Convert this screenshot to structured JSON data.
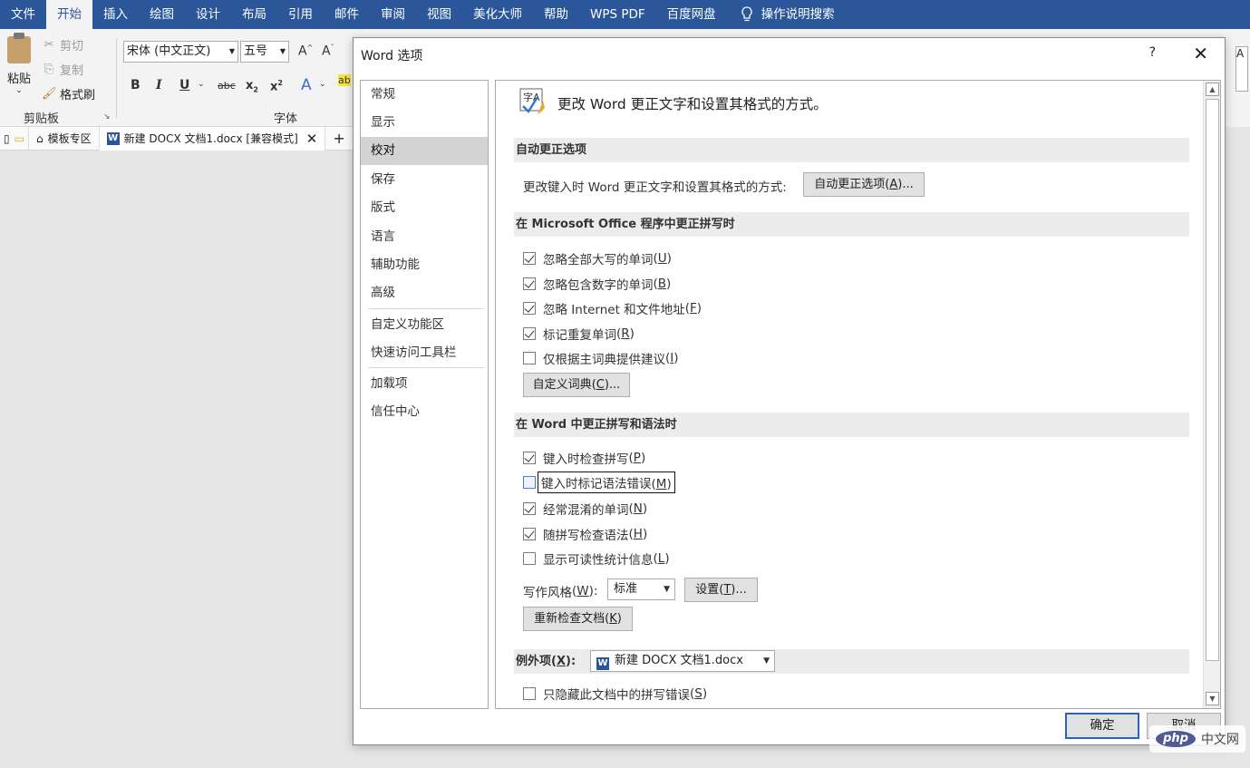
{
  "ribbon": {
    "tabs": [
      "文件",
      "开始",
      "插入",
      "绘图",
      "设计",
      "布局",
      "引用",
      "邮件",
      "审阅",
      "视图",
      "美化大师",
      "帮助",
      "WPS PDF",
      "百度网盘"
    ],
    "active_tab": "开始",
    "search_label": "操作说明搜索",
    "clipboard": {
      "paste": "粘贴",
      "cut": "剪切",
      "copy": "复制",
      "format_painter": "格式刷",
      "group_label": "剪贴板"
    },
    "font": {
      "font_name": "宋体 (中文正文)",
      "font_size": "五号",
      "group_label": "字体"
    },
    "right_partial": "A"
  },
  "doc_tabs": {
    "template": "模板专区",
    "document": "新建 DOCX 文档1.docx [兼容模式]"
  },
  "dialog": {
    "title": "Word 选项",
    "help": "?",
    "nav": [
      "常规",
      "显示",
      "校对",
      "保存",
      "版式",
      "语言",
      "辅助功能",
      "高级",
      "自定义功能区",
      "快速访问工具栏",
      "加载项",
      "信任中心"
    ],
    "selected_nav": "校对",
    "header": "更改 Word 更正文字和设置其格式的方式。",
    "autocorrect": {
      "section": "自动更正选项",
      "desc": "更改键入时 Word 更正文字和设置其格式的方式:",
      "button": "自动更正选项",
      "button_key": "A",
      "button_suffix": "..."
    },
    "office_spelling": {
      "section": "在 Microsoft Office 程序中更正拼写时",
      "options": [
        {
          "label": "忽略全部大写的单词",
          "key": "U",
          "checked": true
        },
        {
          "label": "忽略包含数字的单词",
          "key": "B",
          "checked": true
        },
        {
          "label": "忽略 Internet 和文件地址",
          "key": "F",
          "checked": true
        },
        {
          "label": "标记重复单词",
          "key": "R",
          "checked": true
        },
        {
          "label": "仅根据主词典提供建议",
          "key": "I",
          "checked": false
        }
      ],
      "custom_dict_button": "自定义词典",
      "custom_dict_key": "C",
      "custom_dict_suffix": "..."
    },
    "word_spelling": {
      "section": "在 Word 中更正拼写和语法时",
      "options": [
        {
          "label": "键入时检查拼写",
          "key": "P",
          "checked": true
        },
        {
          "label": "键入时标记语法错误",
          "key": "M",
          "checked": false
        },
        {
          "label": "经常混淆的单词",
          "key": "N",
          "checked": true
        },
        {
          "label": "随拼写检查语法",
          "key": "H",
          "checked": true
        },
        {
          "label": "显示可读性统计信息",
          "key": "L",
          "checked": false
        }
      ],
      "writing_style_label": "写作风格",
      "writing_style_key": "W",
      "writing_style_value": "标准",
      "settings_button": "设置",
      "settings_key": "T",
      "settings_suffix": "...",
      "recheck_button": "重新检查文档",
      "recheck_key": "K"
    },
    "exceptions": {
      "label": "例外项",
      "key": "X",
      "document": "新建 DOCX 文档1.docx",
      "hide_errors_label": "只隐藏此文档中的拼写错误",
      "hide_errors_key": "S",
      "hide_errors_checked": false
    },
    "ok": "确定",
    "cancel": "取消"
  },
  "watermark": {
    "logo": "php",
    "site": "中文网"
  }
}
